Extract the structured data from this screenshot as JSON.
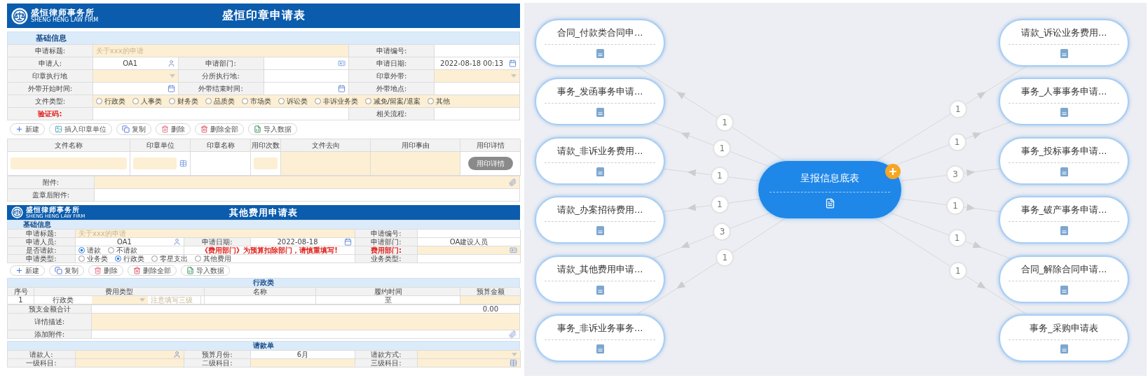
{
  "seal_form": {
    "logo": {
      "name": "盛恒律师事务所",
      "subtitle": "SHENG HENG LAW FIRM"
    },
    "title": "盛恒印章申请表",
    "section": "基础信息",
    "rows": [
      {
        "fields": [
          {
            "label": "申请标题:",
            "input": {
              "kind": "text",
              "placeholder": "关于xxx的申请",
              "required": true
            }
          },
          {
            "label": "申请编号:",
            "input": {
              "kind": "text",
              "required": false
            }
          }
        ]
      },
      {
        "fields": [
          {
            "label": "申请人:",
            "input": {
              "kind": "user",
              "value": "OA1",
              "required": false
            }
          },
          {
            "label": "申请部门:",
            "input": {
              "kind": "dept",
              "required": false
            }
          },
          {
            "label": "申请日期:",
            "input": {
              "kind": "date",
              "value": "2022-08-18 00:13",
              "required": false
            }
          }
        ]
      },
      {
        "fields": [
          {
            "label": "印章执行地",
            "input": {
              "kind": "select",
              "required": true
            }
          },
          {
            "label": "分所执行地:",
            "input": {
              "kind": "text",
              "required": false
            }
          },
          {
            "label": "印章外带:",
            "input": {
              "kind": "select",
              "required": true
            }
          }
        ]
      },
      {
        "fields": [
          {
            "label": "外带开始时间:",
            "input": {
              "kind": "date",
              "required": false
            }
          },
          {
            "label": "外带结束时间:",
            "input": {
              "kind": "date",
              "required": false
            }
          },
          {
            "label": "外带地点:",
            "input": {
              "kind": "text",
              "required": false
            }
          }
        ]
      },
      {
        "fields": [
          {
            "label": "文件类型:",
            "input": {
              "kind": "radio",
              "required": true,
              "options": [
                {
                  "label": "行政类",
                  "selected": false
                },
                {
                  "label": "人事类",
                  "selected": false
                },
                {
                  "label": "财务类",
                  "selected": false
                },
                {
                  "label": "品质类",
                  "selected": false
                },
                {
                  "label": "市场类",
                  "selected": false
                },
                {
                  "label": "诉讼类",
                  "selected": false
                },
                {
                  "label": "非诉业务类",
                  "selected": false
                },
                {
                  "label": "减免/留案/退案",
                  "selected": false
                },
                {
                  "label": "其他",
                  "selected": false
                }
              ]
            }
          }
        ]
      },
      {
        "fields": [
          {
            "label": "验证码:",
            "alert": true,
            "input": {
              "kind": "text",
              "required": false
            }
          },
          {
            "label": "相关流程:",
            "alert": false,
            "input": {
              "kind": "text",
              "required": false
            }
          }
        ]
      }
    ],
    "toolbar": [
      {
        "kind": "add",
        "label": "新建"
      },
      {
        "kind": "insert",
        "label": "插入印章单位"
      },
      {
        "kind": "copy",
        "label": "复制"
      },
      {
        "kind": "delete",
        "label": "删除"
      },
      {
        "kind": "delete_all",
        "label": "删除全部"
      },
      {
        "kind": "import",
        "label": "导入数据"
      }
    ],
    "table": {
      "columns": [
        "文件名称",
        "印章单位",
        "印章名称",
        "用印次数",
        "文件去向",
        "用印事由",
        "用印详情"
      ],
      "rows": [
        {
          "cells": [
            {
              "kind": "textbox",
              "required": true
            },
            {
              "kind": "picker",
              "required": true
            },
            {
              "kind": "text",
              "required": false
            },
            {
              "kind": "textbox",
              "required": true
            },
            {
              "kind": "text",
              "required": true
            },
            {
              "kind": "text",
              "required": true
            },
            {
              "kind": "button",
              "label": "用印详情"
            }
          ]
        }
      ]
    },
    "attachments": [
      {
        "fields": [
          {
            "label": "附件:",
            "input": {
              "kind": "file",
              "required": true
            }
          }
        ]
      },
      {
        "fields": [
          {
            "label": "盖章后附件:",
            "input": {
              "kind": "text",
              "required": false
            }
          }
        ]
      }
    ]
  },
  "expense_form": {
    "logo": {
      "name": "盛恒律师事务所",
      "subtitle": "SHENG HENG LAW FIRM"
    },
    "title": "其他费用申请表",
    "section": "基础信息",
    "rows": [
      {
        "fields": [
          {
            "label": "申请标题:",
            "input": {
              "kind": "text",
              "placeholder": "关于xxx的申请",
              "required": true
            }
          },
          {
            "label": "申请编号:",
            "input": {
              "kind": "text",
              "required": false
            }
          }
        ]
      },
      {
        "fields": [
          {
            "label": "申请人员:",
            "input": {
              "kind": "user",
              "value": "OA1",
              "required": false
            }
          },
          {
            "label": "申请日期:",
            "input": {
              "kind": "date",
              "value": "2022-08-18",
              "required": false
            }
          },
          {
            "label": "申请部门:",
            "input": {
              "kind": "text",
              "value": "OA建设人员",
              "required": false
            }
          }
        ]
      },
      {
        "fields": [
          {
            "label": "是否请款:",
            "input": {
              "kind": "radio",
              "required": false,
              "options": [
                {
                  "label": "请款",
                  "selected": true
                },
                {
                  "label": "不请款",
                  "selected": false
                }
              ]
            }
          },
          {
            "notice": "《费用部门》为预算扣除部门，请慎重填写!"
          },
          {
            "label": "费用部门:",
            "alert": true,
            "input": {
              "kind": "dept",
              "required": true
            }
          }
        ]
      },
      {
        "fields": [
          {
            "label": "申请类型:",
            "input": {
              "kind": "radio",
              "required": false,
              "options": [
                {
                  "label": "业务类",
                  "selected": false
                },
                {
                  "label": "行政类",
                  "selected": true
                },
                {
                  "label": "零星支出",
                  "selected": false
                },
                {
                  "label": "其他费用",
                  "selected": false
                }
              ]
            }
          },
          {
            "label": "业务类型:",
            "input": {
              "kind": "text",
              "required": false
            }
          }
        ]
      }
    ],
    "toolbar": [
      {
        "kind": "add",
        "label": "新建"
      },
      {
        "kind": "copy",
        "label": "复制"
      },
      {
        "kind": "delete",
        "label": "删除"
      },
      {
        "kind": "delete_all",
        "label": "删除全部"
      },
      {
        "kind": "import",
        "label": "导入数据"
      }
    ],
    "detail_section": "行政类",
    "table": {
      "columns": [
        "序号",
        "费用类型",
        "名称",
        "履约时间",
        "预算金额"
      ],
      "rows": [
        {
          "cells": [
            {
              "kind": "value",
              "value": "1"
            },
            {
              "kind": "expense_type",
              "value": "行政类",
              "placeholder": "注意填写三级",
              "required": true
            },
            {
              "kind": "text",
              "required": false
            },
            {
              "kind": "text",
              "value": "至",
              "required": false
            },
            {
              "kind": "text",
              "required": true
            }
          ]
        }
      ]
    },
    "summary": [
      {
        "fields": [
          {
            "label": "预支金额合计",
            "input": {
              "kind": "amount",
              "value": "0.00"
            }
          }
        ]
      },
      {
        "fields": [
          {
            "label": "详情描述:",
            "input": {
              "kind": "memo",
              "required": true
            }
          }
        ]
      },
      {
        "fields": [
          {
            "label": "添加附件:",
            "input": {
              "kind": "file",
              "required": false
            }
          }
        ]
      }
    ],
    "request_section": "请款单",
    "request_rows": [
      {
        "fields": [
          {
            "label": "请款人:",
            "input": {
              "kind": "user",
              "required": true
            }
          },
          {
            "label": "预算月份:",
            "input": {
              "kind": "text",
              "value": "6月",
              "required": false
            }
          },
          {
            "label": "请款方式:",
            "input": {
              "kind": "select",
              "required": true
            }
          }
        ]
      },
      {
        "fields": [
          {
            "label": "一级科目:",
            "input": {
              "kind": "text",
              "required": true
            }
          },
          {
            "label": "二级科目:",
            "input": {
              "kind": "text",
              "required": true
            }
          },
          {
            "label": "三级科目:",
            "input": {
              "kind": "lookup",
              "required": true
            }
          }
        ]
      }
    ]
  },
  "mind_map": {
    "center": {
      "title": "呈报信息底表"
    },
    "left": [
      {
        "title": "合同_付款类合同申...",
        "count": "1"
      },
      {
        "title": "事务_发函事务申请...",
        "count": "1"
      },
      {
        "title": "请款_非诉业务费用...",
        "count": "1"
      },
      {
        "title": "请款_办案招待费用...",
        "count": "1"
      },
      {
        "title": "请款_其他费用申请...",
        "count": "3"
      },
      {
        "title": "事务_非诉业务事务...",
        "count": "1"
      }
    ],
    "right": [
      {
        "title": "请款_诉讼业务费用...",
        "count": "1"
      },
      {
        "title": "事务_人事事务申请...",
        "count": "1"
      },
      {
        "title": "事务_投标事务申请...",
        "count": "3"
      },
      {
        "title": "事务_破产事务申请...",
        "count": "1"
      },
      {
        "title": "合同_解除合同申请...",
        "count": "1"
      },
      {
        "title": "事务_采购申请表",
        "count": "1"
      }
    ]
  }
}
